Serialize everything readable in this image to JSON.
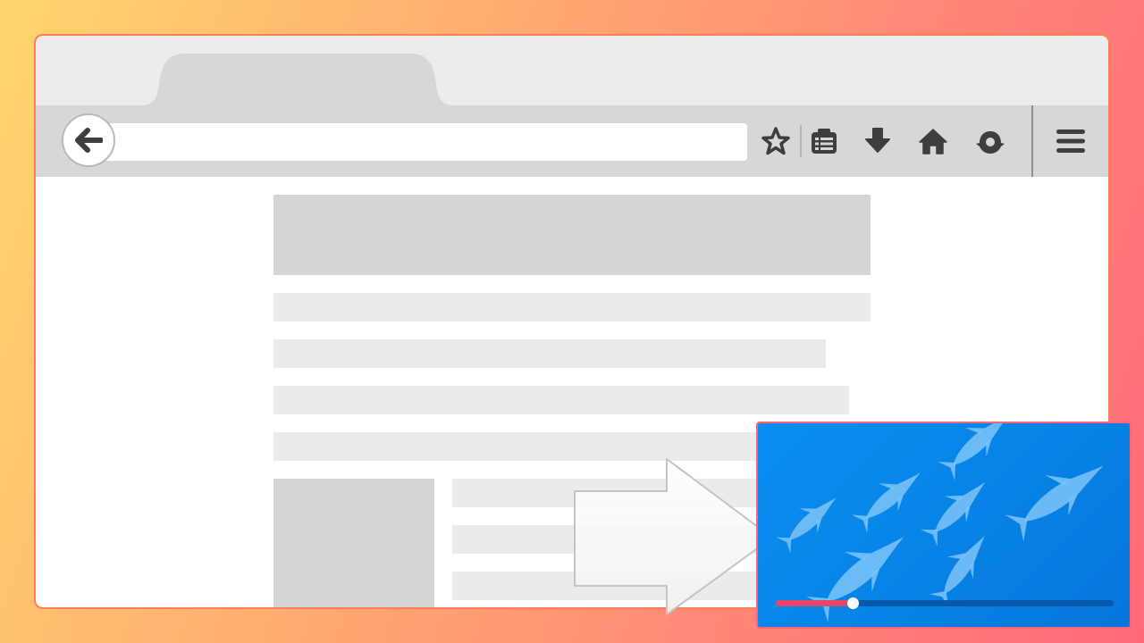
{
  "browser": {
    "toolbar": {
      "url_value": "",
      "icons": [
        "back-arrow-icon",
        "star-icon",
        "reading-list-icon",
        "download-icon",
        "home-icon",
        "pocket-icon",
        "menu-icon"
      ]
    }
  },
  "pip_player": {
    "progress": 0.23,
    "colors": {
      "background": "#0a86e8",
      "played": "#e8456a",
      "track": "#075aa8",
      "fish": "#7cc4f8"
    }
  },
  "colors": {
    "window_border": "#ff7d52",
    "tabstrip": "#ececec",
    "toolbar": "#d7d7d7",
    "placeholder_dark": "#d6d6d6",
    "placeholder_light": "#ebebeb"
  }
}
